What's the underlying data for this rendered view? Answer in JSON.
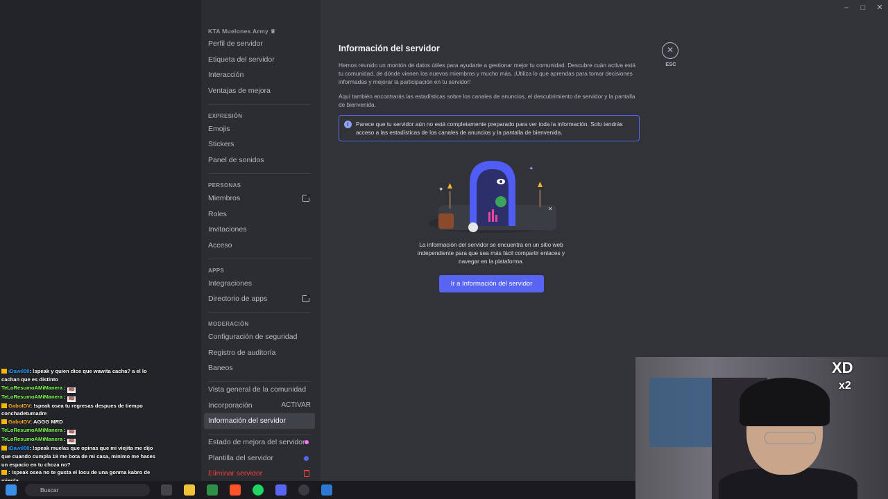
{
  "server_name": "KTA Muelones Army ♛",
  "nav": {
    "top": [
      {
        "label": "Perfil de servidor"
      },
      {
        "label": "Etiqueta del servidor"
      },
      {
        "label": "Interacción"
      },
      {
        "label": "Ventajas de mejora"
      }
    ],
    "expresion": {
      "title": "EXPRESIÓN",
      "items": [
        "Emojis",
        "Stickers",
        "Panel de sonidos"
      ]
    },
    "personas": {
      "title": "PERSONAS",
      "items": [
        "Miembros",
        "Roles",
        "Invitaciones",
        "Acceso"
      ]
    },
    "apps": {
      "title": "APPS",
      "items": [
        "Integraciones",
        "Directorio de apps"
      ]
    },
    "moderacion": {
      "title": "MODERACIÓN",
      "items": [
        "Configuración de seguridad",
        "Registro de auditoría",
        "Baneos"
      ]
    },
    "community": [
      {
        "label": "Vista general de la comunidad"
      },
      {
        "label": "Incorporación",
        "right": "ACTIVAR"
      },
      {
        "label": "Información del servidor"
      }
    ],
    "bottom": [
      "Estado de mejora del servidor",
      "Plantilla del servidor"
    ],
    "delete": "Eliminar servidor"
  },
  "page": {
    "title": "Información del servidor",
    "para1": "Hemos reunido un montón de datos útiles para ayudarte a gestionar mejor tu comunidad. Descubre cuán activa está tu comunidad, de dónde vienen los nuevos miembros y mucho más. ¡Utiliza lo que aprendas para tomar decisiones informadas y mejorar la participación en tu servidor!",
    "para2": "Aquí también encontrarás las estadísticas sobre los canales de anuncios, el descubrimiento de servidor y la pantalla de bienvenida.",
    "notice": "Parece que tu servidor aún no está completamente preparado para ver toda la información. Solo tendrás acceso a las estadísticas de los canales de anuncios y la pantalla de bienvenida.",
    "caption": "La información del servidor se encuentra en un sitio web independiente para que sea más fácil compartir enlaces y navegar en la plataforma.",
    "cta": "Ir a Información del servidor"
  },
  "esc": {
    "icon": "✕",
    "label": "ESC"
  },
  "window": {
    "min": "–",
    "max": "□",
    "close": "✕"
  },
  "chat": [
    {
      "user": "iDawil08",
      "color": "blue",
      "text": ": !speak y quien dice que wawita cacha? a el lo cachan que es distinto"
    },
    {
      "user": "TeLoResumoAMiManera",
      "color": "green",
      "text": " :",
      "xd": "XD"
    },
    {
      "user": "TeLoResumoAMiManera",
      "color": "green",
      "text": " :",
      "xd": "XD"
    },
    {
      "user": "GaboIDV",
      "color": "orange",
      "text": ": !speak osea tu regresas despues de tiempo conchadetumadre"
    },
    {
      "user": "GaboIDV",
      "color": "orange",
      "text": ": AGGG MRD"
    },
    {
      "user": "TeLoResumoAMiManera",
      "color": "green",
      "text": " :",
      "xd": "XD"
    },
    {
      "user": "TeLoResumoAMiManera",
      "color": "green",
      "text": " :",
      "xd": "XD"
    },
    {
      "user": "iDawil08",
      "color": "blue",
      "text": ": !speak muelas que opinas que mi viejita me dijo que cuando cumpla 18 me bota de mi casa, minimo me haces un espacio en tu choza no?"
    },
    {
      "user": "",
      "color": "orange",
      "text": ": !speak osea no te gusta el locu de una gonma kabro de mierda"
    }
  ],
  "taskbar": {
    "search": "Buscar"
  },
  "webcam": {
    "stamp": "XD",
    "stamp2": "x2"
  }
}
